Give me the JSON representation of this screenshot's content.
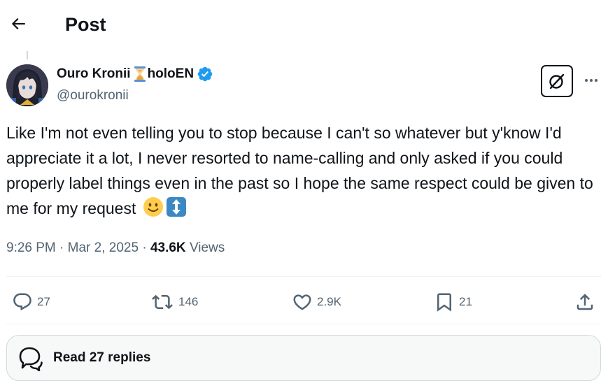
{
  "header": {
    "title": "Post"
  },
  "author": {
    "display_name": "Ouro Kronii",
    "name_suffix": "holoEN",
    "handle": "@ourokronii",
    "verified": true
  },
  "tweet": {
    "text": "Like I'm not even telling you to stop because I can't so whatever but y'know I'd appreciate it a lot, I never resorted to name-calling and only asked if you could properly label things even in the past so I hope the same respect could be given to me for my request",
    "time": "9:26 PM",
    "separator": "·",
    "date": "Mar 2, 2025",
    "views_count": "43.6K",
    "views_label": "Views"
  },
  "actions": {
    "replies": "27",
    "reposts": "146",
    "likes": "2.9K",
    "bookmarks": "21"
  },
  "replies_button": {
    "label": "Read 27 replies"
  },
  "colors": {
    "verified": "#1d9bf0",
    "text": "#0f1419",
    "muted": "#536471",
    "border": "#cfd9de"
  },
  "icons": [
    "back-arrow-icon",
    "hourglass-icon",
    "verified-badge-icon",
    "grok-icon",
    "more-icon",
    "reply-icon",
    "repost-icon",
    "like-icon",
    "bookmark-icon",
    "share-icon",
    "speech-bubbles-icon",
    "slightly-smiling-face-icon",
    "up-down-arrow-icon"
  ]
}
